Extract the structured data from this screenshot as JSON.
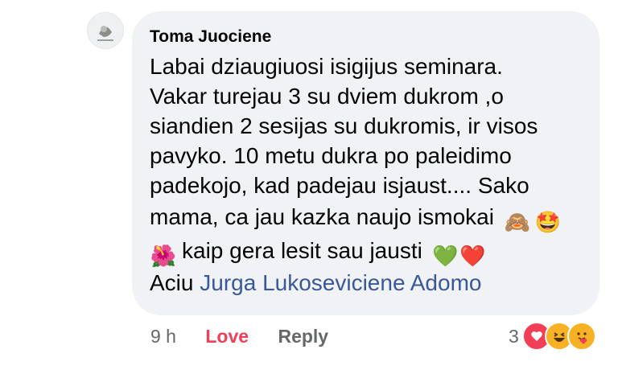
{
  "comment": {
    "author": "Toma Juociene",
    "lines": [
      "Labai dziaugiuosi isigijus seminara.",
      "Vakar turejau 3 su dviem dukrom ,o",
      "siandien 2 sesijas su dukromis, ir visos",
      "pavyko. 10 metu dukra po paleidimo",
      "padekojo, kad padejau isjaust.... Sako",
      "mama, ca jau kazka naujo ismokai"
    ],
    "line7_text": "kaip gera lesit sau jausti",
    "last_line_prefix": "Aciu ",
    "mention": "Jurga Lukoseviciene Adomo",
    "emojis": [
      "see-no-evil-monkey-icon",
      "star-struck-icon",
      "hibiscus-icon",
      "green-heart-icon",
      "red-heart-icon"
    ]
  },
  "footer": {
    "time": "9 h",
    "love_label": "Love",
    "reply_label": "Reply",
    "reaction_count": "3",
    "reactions": [
      "love-reaction-icon",
      "haha-reaction-icon",
      "care-reaction-icon"
    ]
  },
  "colors": {
    "bubble": "#f0f2f5",
    "love": "#f33e58",
    "link": "#385898",
    "meta": "#65676b"
  }
}
